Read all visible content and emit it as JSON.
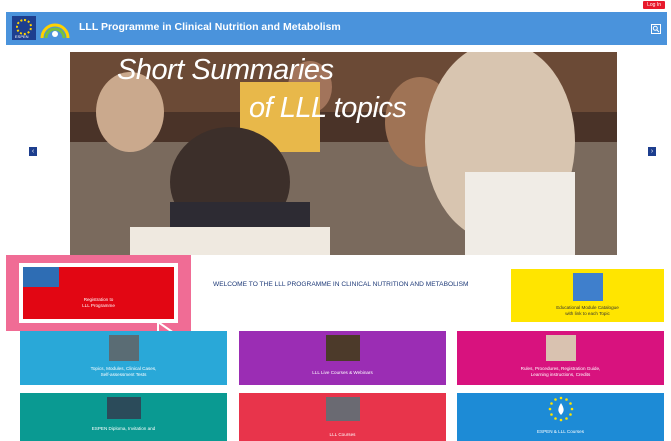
{
  "header": {
    "login_label": "Log In",
    "title": "LLL Programme in Clinical Nutrition and Metabolism",
    "logo_text": "ESPEN"
  },
  "carousel": {
    "caption_line1": "Short Summaries",
    "caption_line2": "of  LLL topics",
    "prev_label": "‹",
    "next_label": "›"
  },
  "welcome_text": "WELCOME TO THE LLL PROGRAMME IN CLINICAL NUTRITION AND METABOLISM",
  "tiles": {
    "registration": {
      "line1": "Registration to",
      "line2": "LLL Programme"
    },
    "catalogue": {
      "line1": "Educational Module Catalogue",
      "line2": "with link to each Topic"
    },
    "topics": {
      "line1": "Topics, Modules, Clinical Cases,",
      "line2": "Self-assessment Tests"
    },
    "live_courses": {
      "line1": "LLL Live Courses & Webinars"
    },
    "rules": {
      "line1": "Rules, Procedures, Registration Guide,",
      "line2": "Learning instructions, Credits"
    },
    "espen_diploma": {
      "line1": "ESPEN Diploma, Invitation and"
    },
    "lll_courses": {
      "line1": "LLL Courses"
    },
    "espen_courses": {
      "line1": "ESPEN & LLL Courses"
    }
  },
  "colors": {
    "header_blue": "#4a93dc",
    "login_red": "#e8192c",
    "registration_red": "#e20613",
    "catalogue_yellow": "#ffe500",
    "topics_blue": "#29a8d8",
    "live_purple": "#9b2db4",
    "rules_pink": "#d8127e",
    "diploma_teal": "#0a9a92",
    "lll_red": "#e8344b",
    "espen_blue": "#1d8bd6",
    "highlight_pink": "#f06c95"
  }
}
